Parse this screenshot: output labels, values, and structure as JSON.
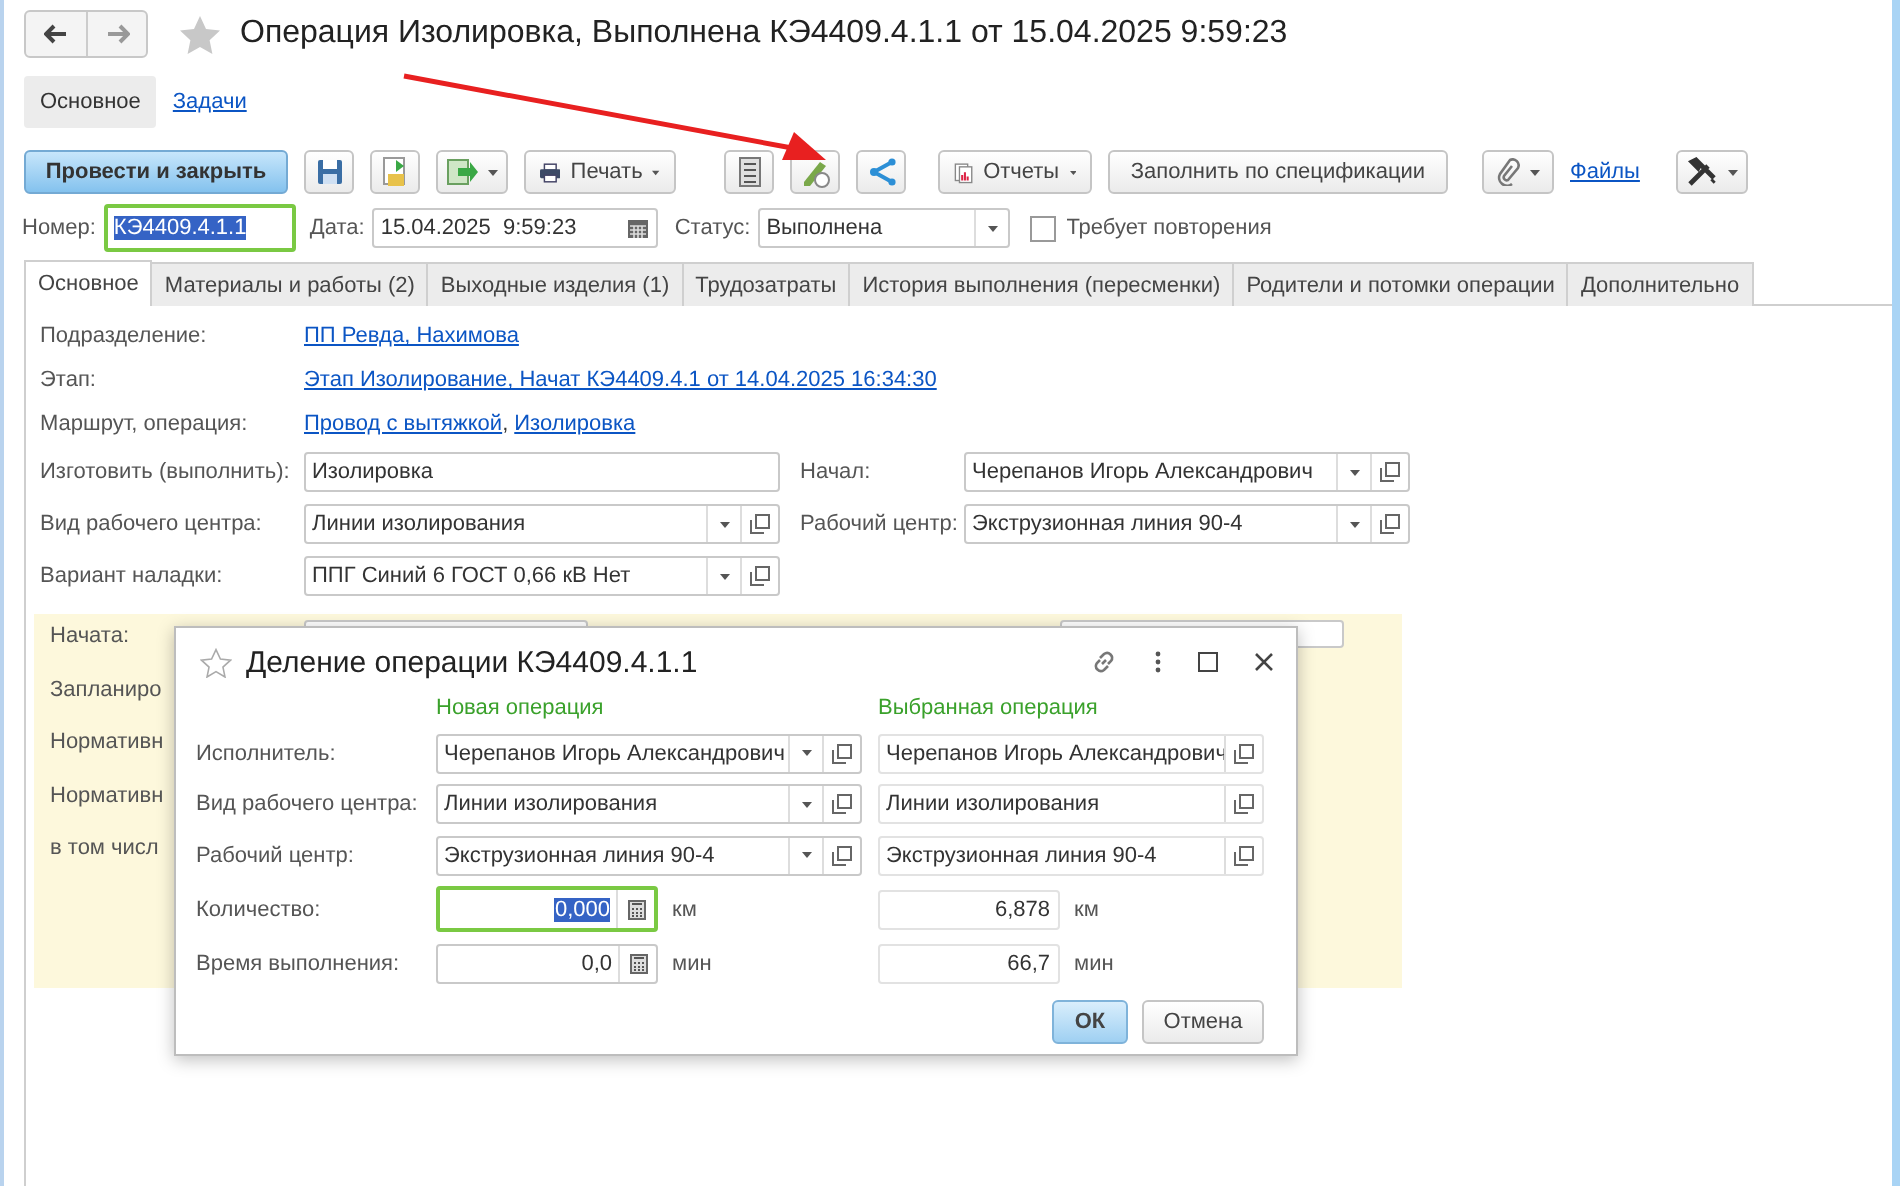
{
  "window": {
    "title": "Операция Изолировка, Выполнена КЭ4409.4.1.1 от 15.04.2025 9:59:23",
    "favorite": false
  },
  "sections": [
    {
      "label": "Основное",
      "selected": true
    },
    {
      "label": "Задачи",
      "selected": false
    }
  ],
  "toolbar": {
    "primary": "Провести и закрыть",
    "print": "Печать",
    "reports": "Отчеты",
    "fill": "Заполнить по спецификации",
    "files": "Файлы"
  },
  "header": {
    "number_label": "Номер:",
    "number": "КЭ4409.4.1.1",
    "number_focused": true,
    "date_label": "Дата:",
    "date": "15.04.2025  9:59:23",
    "status_label": "Статус:",
    "status": "Выполнена",
    "repeat_label": "Требует повторения",
    "repeat_checked": false
  },
  "tabs": [
    {
      "label": "Основное",
      "selected": true
    },
    {
      "label": "Материалы и работы (2)",
      "selected": false
    },
    {
      "label": "Выходные изделия (1)",
      "selected": false
    },
    {
      "label": "Трудозатраты",
      "selected": false
    },
    {
      "label": "История выполнения (пересменки)",
      "selected": false
    },
    {
      "label": "Родители и потомки операции",
      "selected": false
    },
    {
      "label": "Дополнительно",
      "selected": false
    }
  ],
  "links": [
    {
      "label": "Подразделение:",
      "values": [
        "ПП Ревда, Нахимова"
      ]
    },
    {
      "label": "Этап:",
      "values": [
        "Этап Изолирование, Начат КЭ4409.4.1 от 14.04.2025 16:34:30"
      ]
    },
    {
      "label": "Маршрут, операция:",
      "values": [
        "Провод с вытяжкой",
        "Изолировка"
      ],
      "separator": ","
    }
  ],
  "fields": [
    {
      "label": "Изготовить (выполнить):",
      "kind": "text",
      "value": "Изолировка",
      "right": {
        "label": "Начал:",
        "kind": "select",
        "value": "Черепанов Игорь Александрович"
      }
    },
    {
      "label": "Вид рабочего центра:",
      "kind": "select",
      "value": "Линии изолирования",
      "right": {
        "label": "Рабочий центр:",
        "kind": "select",
        "value": "Экструзионная линия 90-4"
      }
    },
    {
      "label": "Вариант наладки:",
      "kind": "select",
      "value": "ППГ Синий 6 ГОСТ 0,66 кВ Нет"
    }
  ],
  "schedule": {
    "labels": [
      "Начата:",
      "Запланиро",
      "Нормативн",
      "Нормативн",
      "в том числ"
    ]
  },
  "dialog": {
    "title": "Деление операции КЭ4409.4.1.1",
    "favorite": false,
    "new_heading": "Новая операция",
    "selected_heading": "Выбранная операция",
    "rows": [
      {
        "label": "Исполнитель:",
        "new": "Черепанов Игорь Александрович",
        "current": "Черепанов Игорь Александрович"
      },
      {
        "label": "Вид рабочего центра:",
        "new": "Линии изолирования",
        "current": "Линии изолирования"
      },
      {
        "label": "Рабочий центр:",
        "new": "Экструзионная линия 90-4",
        "current": "Экструзионная линия 90-4"
      }
    ],
    "amounts": [
      {
        "label": "Количество:",
        "new": "0,000",
        "focused": true,
        "unit": "км",
        "current": "6,878",
        "current_unit": "км"
      },
      {
        "label": "Время выполнения:",
        "new": "0,0",
        "focused": false,
        "unit": "мин",
        "current": "66,7",
        "current_unit": "мин"
      }
    ],
    "ok": "ОК",
    "cancel": "Отмена"
  }
}
